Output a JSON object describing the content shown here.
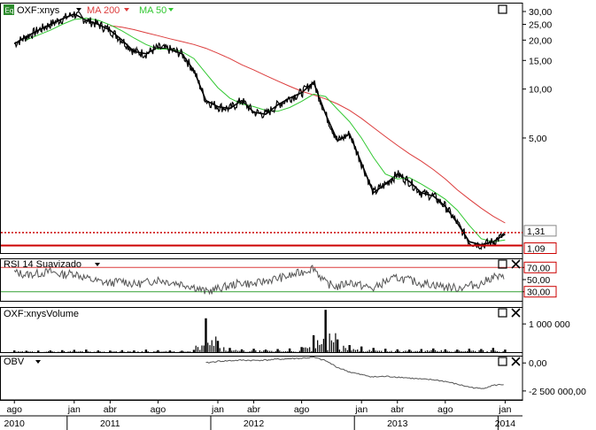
{
  "chart_data": [
    {
      "type": "line",
      "panel": "price",
      "symbol_badge": "Eq",
      "title": "OXF:xnys",
      "scale": "log",
      "ylim": [
        0.98,
        34
      ],
      "y_ticks": [
        "30,00",
        "25,00",
        "20,00",
        "15,00",
        "10,00",
        "5,00"
      ],
      "y_tick_values": [
        30,
        25,
        20,
        15,
        10,
        5
      ],
      "x": [
        "2010-08",
        "2010-09",
        "2010-10",
        "2010-11",
        "2010-12",
        "2011-01",
        "2011-02",
        "2011-03",
        "2011-04",
        "2011-05",
        "2011-06",
        "2011-07",
        "2011-08",
        "2011-09",
        "2011-10",
        "2011-11",
        "2011-12",
        "2012-01",
        "2012-02",
        "2012-03",
        "2012-04",
        "2012-05",
        "2012-06",
        "2012-07",
        "2012-08",
        "2012-09",
        "2012-10",
        "2012-11",
        "2012-12",
        "2013-01",
        "2013-02",
        "2013-03",
        "2013-04",
        "2013-05",
        "2013-06",
        "2013-07",
        "2013-08",
        "2013-09",
        "2013-10",
        "2013-11",
        "2013-12",
        "2014-01"
      ],
      "series": [
        {
          "name": "OXF:xnys",
          "color": "#000000",
          "values": [
            19.0,
            21.0,
            23.0,
            25.0,
            27.0,
            29.0,
            26.5,
            25.0,
            23.0,
            20.0,
            17.0,
            16.5,
            18.0,
            17.5,
            16.5,
            13.0,
            8.5,
            7.8,
            7.6,
            8.5,
            7.2,
            7.0,
            8.0,
            8.8,
            9.5,
            11.0,
            7.0,
            4.8,
            5.3,
            3.5,
            2.3,
            2.6,
            3.0,
            2.7,
            2.3,
            2.2,
            1.9,
            1.5,
            1.15,
            1.1,
            1.15,
            1.28
          ]
        },
        {
          "name": "MA 200",
          "color": "#dc3c3c",
          "values": [
            null,
            null,
            null,
            null,
            null,
            null,
            null,
            null,
            24.5,
            24.0,
            23.2,
            22.2,
            21.3,
            20.4,
            19.6,
            18.8,
            17.8,
            16.6,
            15.4,
            14.1,
            13.1,
            12.1,
            11.2,
            10.4,
            9.7,
            9.2,
            8.7,
            8.1,
            7.4,
            6.6,
            5.8,
            5.1,
            4.5,
            4.0,
            3.6,
            3.2,
            2.8,
            2.4,
            2.1,
            1.85,
            1.65,
            1.5
          ]
        },
        {
          "name": "MA 50",
          "color": "#32c832",
          "values": [
            null,
            20.0,
            21.5,
            23.0,
            25.0,
            26.8,
            27.3,
            26.5,
            24.8,
            22.8,
            20.6,
            18.8,
            17.6,
            17.6,
            17.0,
            15.4,
            12.5,
            10.2,
            8.8,
            8.1,
            7.8,
            7.4,
            7.3,
            7.7,
            8.4,
            9.3,
            9.0,
            7.5,
            6.3,
            5.0,
            3.8,
            3.0,
            2.8,
            2.85,
            2.6,
            2.35,
            2.1,
            1.8,
            1.45,
            1.2,
            1.15,
            1.18
          ]
        }
      ],
      "legend": [
        {
          "label": "OXF:xnys",
          "color": "#000000"
        },
        {
          "label": "MA 200",
          "color": "#dc3c3c"
        },
        {
          "label": "MA 50",
          "color": "#32c832"
        }
      ],
      "price_labels": [
        {
          "value": 1.31,
          "label": "1,31",
          "style": "dotted"
        },
        {
          "value": 1.09,
          "label": "1,09",
          "style": "solid"
        }
      ],
      "legend_placement": "top-left"
    },
    {
      "type": "line",
      "panel": "rsi",
      "title": "RSI 14 Suavizado",
      "ylim": [
        15,
        85
      ],
      "y_ticks": [
        "70,00",
        "50,00",
        "30,00"
      ],
      "y_tick_values": [
        70,
        50,
        30
      ],
      "series": [
        {
          "name": "RSI 14 Suavizado",
          "color": "#555555",
          "values": [
            62,
            58,
            60,
            63,
            58,
            61,
            52,
            47,
            44,
            48,
            42,
            45,
            50,
            46,
            43,
            38,
            30,
            35,
            40,
            45,
            42,
            48,
            52,
            56,
            62,
            70,
            44,
            38,
            46,
            40,
            35,
            47,
            53,
            49,
            44,
            42,
            38,
            36,
            40,
            43,
            55,
            52
          ]
        }
      ]
    },
    {
      "type": "bar",
      "panel": "volume",
      "title": "OXF:xnysVolume",
      "ylim": [
        0,
        1600000
      ],
      "y_ticks": [
        "1 000 000"
      ],
      "y_tick_values": [
        1000000
      ],
      "series": [
        {
          "name": "OXF:xnysVolume",
          "color": "#000000",
          "values": [
            60000,
            50000,
            55000,
            60000,
            70000,
            80000,
            90000,
            60000,
            55000,
            70000,
            60000,
            90000,
            70000,
            60000,
            50000,
            80000,
            1200000,
            400000,
            150000,
            100000,
            120000,
            90000,
            110000,
            130000,
            180000,
            600000,
            1500000,
            450000,
            250000,
            200000,
            150000,
            120000,
            100000,
            90000,
            110000,
            130000,
            100000,
            90000,
            120000,
            110000,
            150000,
            90000
          ]
        }
      ]
    },
    {
      "type": "line",
      "panel": "obv",
      "title": "OBV",
      "ylim": [
        -3300000,
        650000
      ],
      "y_ticks": [
        "0,00",
        "-2 500 000,00"
      ],
      "y_tick_values": [
        0,
        -2500000
      ],
      "series": [
        {
          "name": "OBV",
          "color": "#555555",
          "values": [
            0,
            0,
            0,
            0,
            0,
            0,
            0,
            0,
            0,
            0,
            0,
            0,
            0,
            0,
            0,
            0,
            0,
            150000,
            200000,
            250000,
            230000,
            260000,
            330000,
            380000,
            420000,
            500000,
            200000,
            -400000,
            -800000,
            -1050000,
            -1250000,
            -1200000,
            -1250000,
            -1350000,
            -1450000,
            -1500000,
            -1650000,
            -1900000,
            -2150000,
            -2300000,
            -2000000,
            -1900000
          ]
        }
      ]
    }
  ],
  "x_axis": {
    "month_labels": [
      {
        "label": "ago",
        "date": "2010-08"
      },
      {
        "label": "jan",
        "date": "2011-01"
      },
      {
        "label": "abr",
        "date": "2011-04"
      },
      {
        "label": "ago",
        "date": "2011-08"
      },
      {
        "label": "jan",
        "date": "2012-01"
      },
      {
        "label": "abr",
        "date": "2012-04"
      },
      {
        "label": "ago",
        "date": "2012-08"
      },
      {
        "label": "jan",
        "date": "2013-01"
      },
      {
        "label": "abr",
        "date": "2013-04"
      },
      {
        "label": "ago",
        "date": "2013-08"
      },
      {
        "label": "jan",
        "date": "2014-01"
      }
    ],
    "year_labels": [
      {
        "label": "2010",
        "date": "2010-08"
      },
      {
        "label": "2011",
        "date": "2011-04"
      },
      {
        "label": "2012",
        "date": "2012-04"
      },
      {
        "label": "2013",
        "date": "2013-04"
      },
      {
        "label": "2014",
        "date": "2014-01"
      }
    ]
  },
  "ui": {
    "maximize_icon": "square-icon",
    "close_icon": "x-icon",
    "dropdown_icon": "triangle-down-icon"
  }
}
